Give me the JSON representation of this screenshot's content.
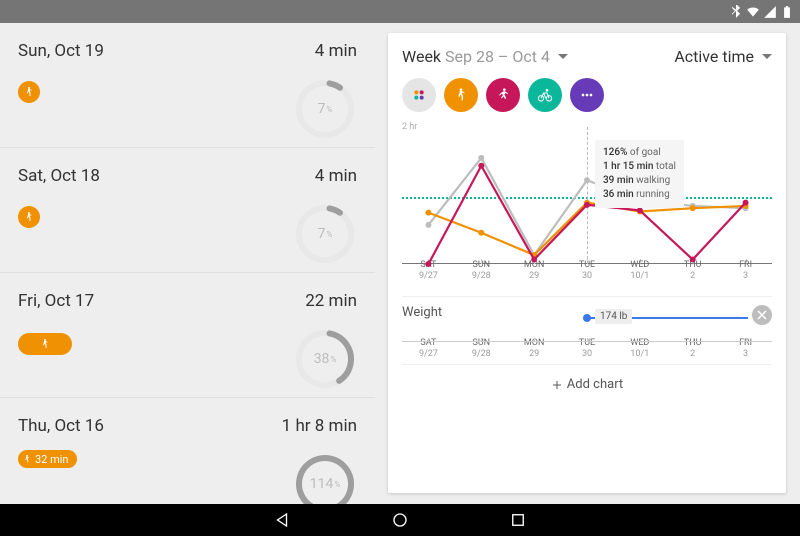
{
  "status": {
    "icons": [
      "bluetooth",
      "wifi",
      "cell",
      "battery"
    ]
  },
  "day_list": [
    {
      "date": "Sun, Oct 19",
      "minutes": "4 min",
      "pct": 7,
      "kind": "icon"
    },
    {
      "date": "Sat, Oct 18",
      "minutes": "4 min",
      "pct": 7,
      "kind": "icon"
    },
    {
      "date": "Fri, Oct 17",
      "minutes": "22 min",
      "pct": 38,
      "kind": "pill"
    },
    {
      "date": "Thu, Oct 16",
      "minutes": "1 hr 8 min",
      "pct": 114,
      "kind": "label",
      "label": "32 min"
    }
  ],
  "card": {
    "week_label": "Week",
    "week_range": "Sep 28 – Oct 4",
    "metric": "Active time"
  },
  "chips": [
    "all",
    "walk",
    "run",
    "bike",
    "more"
  ],
  "chart_data": {
    "type": "line",
    "title": "Active time",
    "ylabel": "",
    "yticks": [
      "2 hr"
    ],
    "ylim_min": 0,
    "ylim_hr": 2,
    "goal_min": 60,
    "categories_top": [
      "SAT",
      "SUN",
      "MON",
      "TUE",
      "WED",
      "THU",
      "FRI"
    ],
    "categories_bot": [
      "9/27",
      "9/28",
      "29",
      "30",
      "10/1",
      "2",
      "3"
    ],
    "series": [
      {
        "name": "total",
        "color": "#bdbdbd",
        "values": [
          35,
          95,
          8,
          75,
          57,
          52,
          50
        ]
      },
      {
        "name": "walking",
        "color": "#ef9100",
        "values": [
          46,
          28,
          8,
          55,
          47,
          50,
          52
        ]
      },
      {
        "name": "running",
        "color": "#c6175b",
        "values": [
          0,
          88,
          4,
          53,
          48,
          4,
          55
        ]
      }
    ],
    "tooltip": {
      "day_index": 3,
      "pct_of_goal": "126%",
      "total": "1 hr 15 min total",
      "walking": "39 min walking",
      "running": "36 min running"
    }
  },
  "weight": {
    "label": "Weight",
    "value": "174",
    "unit": "lb",
    "day_index": 3
  },
  "add_chart": "Add chart",
  "nav": [
    "back",
    "home",
    "recent"
  ]
}
